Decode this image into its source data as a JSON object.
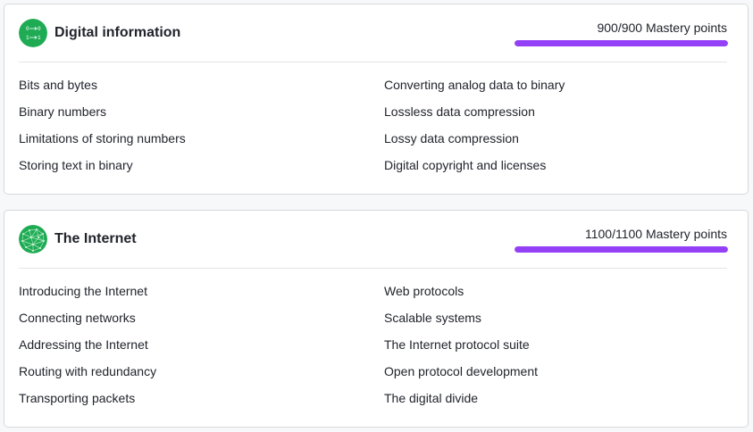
{
  "units": [
    {
      "title": "Digital information",
      "icon": "binary-icon",
      "mastery": {
        "current": 900,
        "total": 900,
        "label": "900/900 Mastery points",
        "progress": 1.0
      },
      "lessons_left": [
        "Bits and bytes",
        "Binary numbers",
        "Limitations of storing numbers",
        "Storing text in binary"
      ],
      "lessons_right": [
        "Converting analog data to binary",
        "Lossless data compression",
        "Lossy data compression",
        "Digital copyright and licenses"
      ]
    },
    {
      "title": "The Internet",
      "icon": "network-globe-icon",
      "mastery": {
        "current": 1100,
        "total": 1100,
        "label": "1100/1100 Mastery points",
        "progress": 1.0
      },
      "lessons_left": [
        "Introducing the Internet",
        "Connecting networks",
        "Addressing the Internet",
        "Routing with redundancy",
        "Transporting packets"
      ],
      "lessons_right": [
        "Web protocols",
        "Scalable systems",
        "The Internet protocol suite",
        "Open protocol development",
        "The digital divide"
      ]
    }
  ],
  "colors": {
    "mastery_bar": "#9440f6",
    "icon_green": "#1fab54",
    "card_border": "#d6d8da",
    "text": "#21242c"
  }
}
